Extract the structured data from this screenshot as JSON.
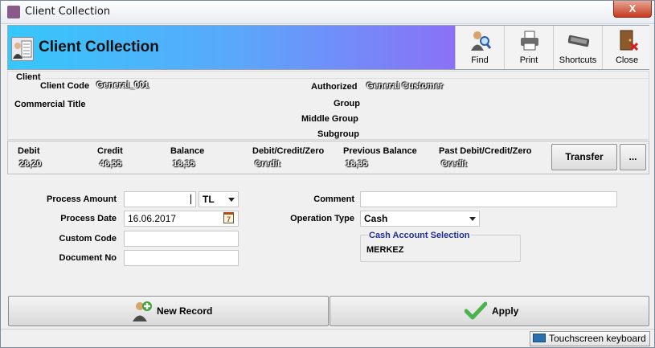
{
  "window": {
    "title": "Client Collection",
    "close_glyph": "X"
  },
  "header": {
    "title": "Client Collection"
  },
  "toolbar": {
    "find": "Find",
    "print": "Print",
    "shortcuts": "Shortcuts",
    "close": "Close"
  },
  "client": {
    "section_label": "Client",
    "client_code_label": "Client Code",
    "client_code_value": "General_001",
    "commercial_title_label": "Commercial Title",
    "authorized_label": "Authorized",
    "authorized_value": "General Customer",
    "group_label": "Group",
    "middle_group_label": "Middle Group",
    "subgroup_label": "Subgroup"
  },
  "finance": {
    "debit_label": "Debit",
    "debit_value": "28,20",
    "credit_label": "Credit",
    "credit_value": "46,55",
    "balance_label": "Balance",
    "balance_value": "18,35",
    "dcz_label": "Debit/Credit/Zero",
    "dcz_value": "Credit",
    "prev_balance_label": "Previous Balance",
    "prev_balance_value": "18,35",
    "past_dcz_label": "Past Debit/Credit/Zero",
    "past_dcz_value": "Credit",
    "transfer_button": "Transfer",
    "more_button": "..."
  },
  "form": {
    "process_amount_label": "Process Amount",
    "process_amount_value": "",
    "currency_value": "TL",
    "process_date_label": "Process Date",
    "process_date_value": "16.06.2017",
    "custom_code_label": "Custom Code",
    "custom_code_value": "",
    "document_no_label": "Document No",
    "document_no_value": "",
    "comment_label": "Comment",
    "comment_value": "",
    "operation_type_label": "Operation Type",
    "operation_type_value": "Cash",
    "cash_account_title": "Cash Account Selection",
    "cash_account_value": "MERKEZ",
    "calendar_glyph": "7"
  },
  "actions": {
    "new_record": "New Record",
    "apply": "Apply"
  },
  "status": {
    "touchscreen_keyboard": "Touchscreen keyboard"
  },
  "colors": {
    "header_start": "#36c7fb",
    "header_end": "#b23de9",
    "cash_title": "#1f2f8f",
    "close_red": "#c73b20"
  }
}
